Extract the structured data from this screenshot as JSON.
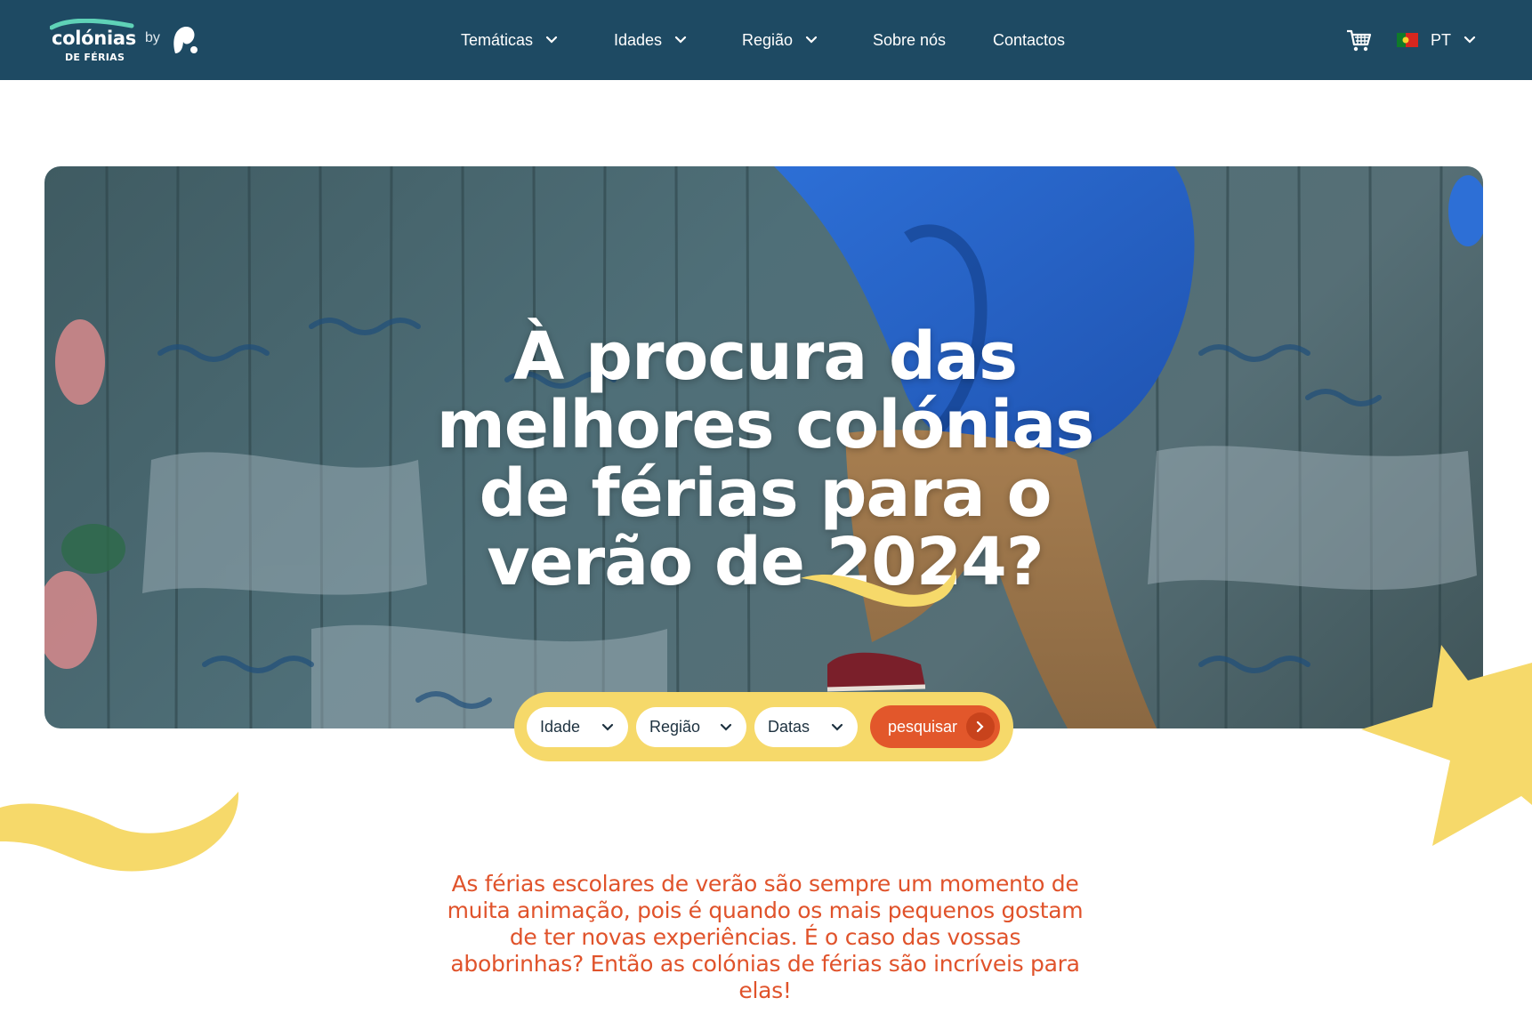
{
  "header": {
    "brand_name": "colónias",
    "brand_sub": "DE FÉRIAS",
    "by_label": "by",
    "nav": [
      {
        "label": "Temáticas",
        "has_dropdown": true
      },
      {
        "label": "Idades",
        "has_dropdown": true
      },
      {
        "label": "Região",
        "has_dropdown": true
      },
      {
        "label": "Sobre nós",
        "has_dropdown": false
      },
      {
        "label": "Contactos",
        "has_dropdown": false
      }
    ],
    "cart_icon": "shopping-cart-icon",
    "language": {
      "label": "PT",
      "flag": "portugal-flag-icon"
    }
  },
  "hero": {
    "title": "À procura das melhores colónias de férias para o verão de 2024?"
  },
  "search": {
    "age_label": "Idade",
    "region_label": "Região",
    "dates_label": "Datas",
    "submit_label": "pesquisar"
  },
  "intro": {
    "text": "As férias escolares de verão são sempre um momento de muita animação, pois é quando os mais pequenos gostam de ter novas experiências. É o caso das vossas abobrinhas? Então as colónias de férias são incríveis para elas!"
  },
  "colors": {
    "header_bg": "#1e4a63",
    "accent_yellow": "#f6d96a",
    "accent_orange": "#e2572b",
    "logo_teal": "#5fd2b7"
  }
}
